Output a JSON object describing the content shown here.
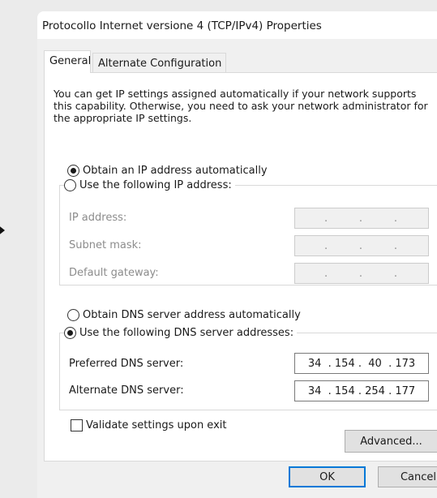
{
  "window": {
    "title": "Protocollo Internet versione 4 (TCP/IPv4) Properties"
  },
  "tabs": [
    {
      "label": "General",
      "active": true
    },
    {
      "label": "Alternate Configuration",
      "active": false
    }
  ],
  "intro_text": "You can get IP settings assigned automatically if your network supports this capability. Otherwise, you need to ask your network administrator for the appropriate IP settings.",
  "ip": {
    "auto_label": "Obtain an IP address automatically",
    "manual_label": "Use the following IP address:",
    "selected": "auto",
    "fields": [
      {
        "label": "IP address:",
        "value": ".      .      ."
      },
      {
        "label": "Subnet mask:",
        "value": ".      .      ."
      },
      {
        "label": "Default gateway:",
        "value": ".      .      ."
      }
    ]
  },
  "dns": {
    "auto_label": "Obtain DNS server address automatically",
    "manual_label": "Use the following DNS server addresses:",
    "selected": "manual",
    "preferred": {
      "label": "Preferred DNS server:",
      "value": "34  . 154 .  40  . 173"
    },
    "alternate": {
      "label": "Alternate DNS server:",
      "value": "34  . 154 . 254 . 177"
    }
  },
  "validate": {
    "label": "Validate settings upon exit",
    "checked": false
  },
  "buttons": {
    "advanced": "Advanced...",
    "ok": "OK",
    "cancel": "Cancel"
  },
  "colors": {
    "accent": "#0078d7",
    "panel": "#ffffff",
    "background": "#f0f0f0"
  }
}
